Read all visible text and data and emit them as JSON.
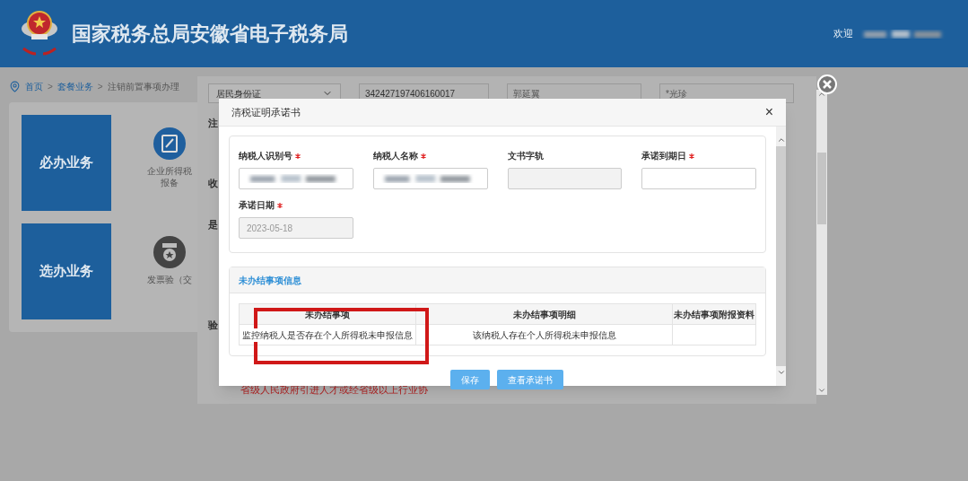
{
  "header": {
    "title": "国家税务总局安徽省电子税务局",
    "welcome": "欢迎"
  },
  "breadcrumb": {
    "separator": ">",
    "items": [
      "首页",
      "套餐业务",
      "注销前置事项办理"
    ]
  },
  "left_panel": {
    "groups": [
      {
        "title": "必办业务",
        "item": {
          "kind": "edit",
          "label": "企业所得税",
          "sublabel": "报备"
        }
      },
      {
        "title": "选办业务",
        "item": {
          "kind": "medal",
          "label": "发票验（交"
        }
      }
    ]
  },
  "background_form": {
    "id_type": "居民身份证",
    "id_number": "342427197406160017",
    "field_3": "郭延翼",
    "field_4": "*光珍",
    "labels": [
      "注",
      "收",
      "是",
      "验"
    ],
    "row_text": "省级人民政府引进人才或经省级以上行业协"
  },
  "dialog": {
    "title": "清税证明承诺书",
    "close": "×",
    "fields": [
      {
        "label": "纳税人识别号",
        "required": true,
        "redacted": true,
        "disabled": false
      },
      {
        "label": "纳税人名称",
        "required": true,
        "redacted": true,
        "disabled": false
      },
      {
        "label": "文书字轨",
        "required": false,
        "redacted": false,
        "disabled": true
      },
      {
        "label": "承诺到期日",
        "required": true,
        "redacted": false,
        "disabled": false
      },
      {
        "label": "承诺日期",
        "required": true,
        "redacted": false,
        "disabled": true,
        "value": "2023-05-18"
      }
    ],
    "section": {
      "title": "未办结事项信息",
      "table": {
        "columns": [
          "未办结事项",
          "未办结事项明细",
          "未办结事项附报资料"
        ],
        "rows": [
          {
            "item": "监控纳税人是否存在个人所得税未申报信息",
            "detail": "该纳税人存在个人所得税未申报信息"
          }
        ]
      }
    },
    "buttons": [
      "保存",
      "查看承诺书"
    ]
  }
}
